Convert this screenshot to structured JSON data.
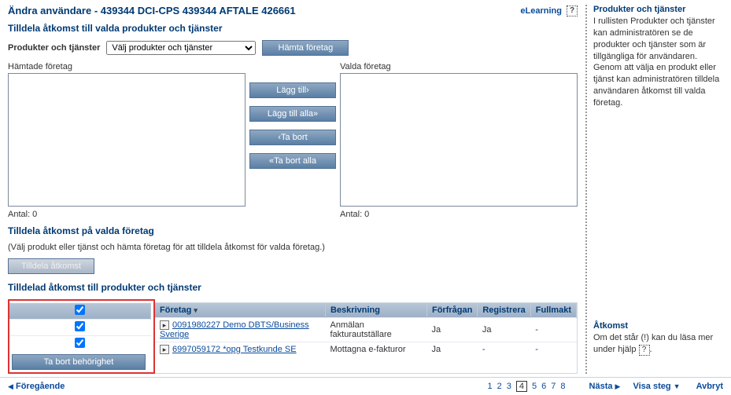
{
  "header": {
    "title": "Ändra användare - 439344 DCI-CPS 439344 AFTALE 426661",
    "elearning": "eLearning"
  },
  "section1": {
    "title": "Tilldela åtkomst till valda produkter och tjänster",
    "products_label": "Produkter och tjänster",
    "select_placeholder": "Välj produkter och tjänster",
    "fetch_btn": "Hämta företag",
    "fetched_label": "Hämtade företag",
    "selected_label": "Valda företag",
    "add": "Lägg till›",
    "add_all": "Lägg till alla»",
    "remove": "‹Ta bort",
    "remove_all": "«Ta bort alla",
    "count_label_l": "Antal:  0",
    "count_label_r": "Antal:  0"
  },
  "section2": {
    "title": "Tilldela åtkomst på valda företag",
    "hint": "(Välj produkt eller tjänst och hämta företag för att tilldela åtkomst för valda företag.)",
    "assign_btn": "Tilldela åtkomst"
  },
  "section3": {
    "title": "Tilldelad åtkomst till produkter och tjänster",
    "cols": {
      "company": "Företag",
      "desc": "Beskrivning",
      "req": "Förfrågan",
      "reg": "Registrera",
      "full": "Fullmakt"
    },
    "rows": [
      {
        "company": "0091980227 Demo DBTS/Business Sverige",
        "desc": "Anmälan fakturautställare",
        "req": "Ja",
        "reg": "Ja",
        "full": "-"
      },
      {
        "company": "6997059172 *opg Testkunde SE",
        "desc": "Mottagna e-fakturor",
        "req": "Ja",
        "reg": "-",
        "full": "-"
      }
    ],
    "remove_btn": "Ta bort behörighet"
  },
  "sidebar": {
    "s1_title": "Produkter och tjänster",
    "s1_body": "I rullisten Produkter och tjänster kan administratören se de produkter och tjänster som är tillgängliga för användaren. Genom att välja en produkt eller tjänst kan administratören tilldela användaren åtkomst till valda företag.",
    "s2_title": "Åtkomst",
    "s2_body_a": "Om det står (!) kan du läsa mer under hjälp "
  },
  "footer": {
    "prev": "Föregående",
    "next": "Nästa",
    "show_step": "Visa steg",
    "cancel": "Avbryt",
    "pages": [
      "1",
      "2",
      "3",
      "4",
      "5",
      "6",
      "7",
      "8"
    ],
    "current": "4"
  }
}
